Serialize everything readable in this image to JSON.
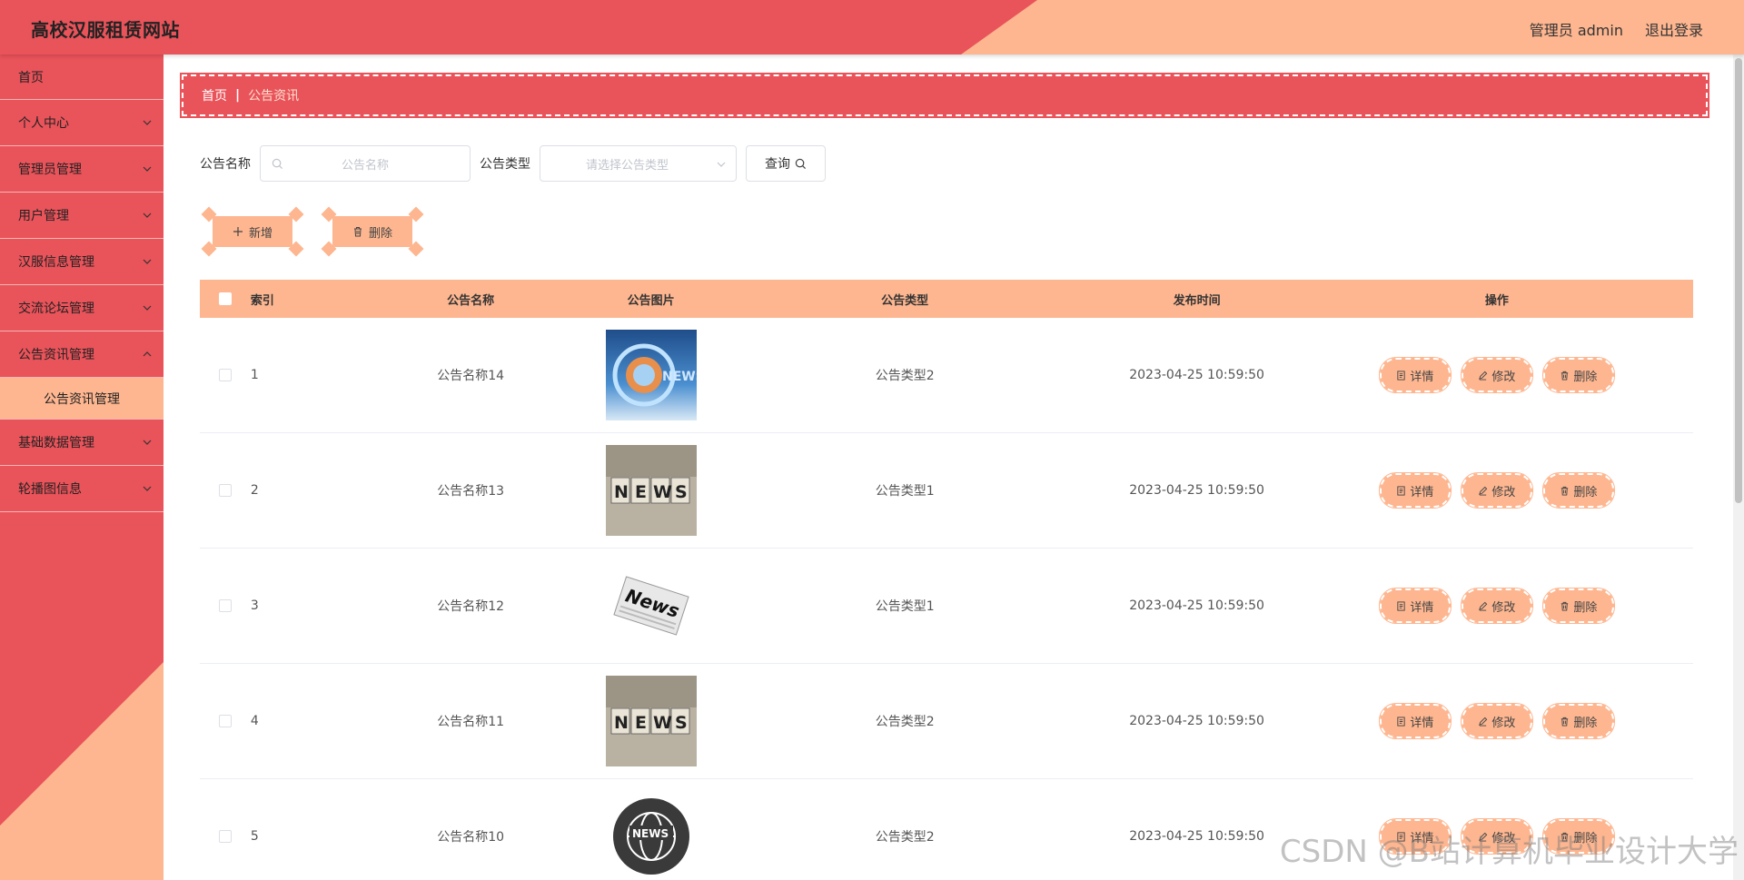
{
  "header": {
    "title": "高校汉服租赁网站",
    "user": "管理员 admin",
    "logout": "退出登录"
  },
  "sidebar": {
    "items": [
      {
        "label": "首页"
      },
      {
        "label": "个人中心"
      },
      {
        "label": "管理员管理"
      },
      {
        "label": "用户管理"
      },
      {
        "label": "汉服信息管理"
      },
      {
        "label": "交流论坛管理"
      },
      {
        "label": "公告资讯管理"
      },
      {
        "label": "基础数据管理"
      },
      {
        "label": "轮播图信息"
      }
    ],
    "active_sub": "公告资讯管理"
  },
  "breadcrumb": {
    "home": "首页",
    "sep": "|",
    "current": "公告资讯"
  },
  "search": {
    "name_label": "公告名称",
    "name_placeholder": "公告名称",
    "type_label": "公告类型",
    "type_placeholder": "请选择公告类型",
    "query": "查询"
  },
  "actions": {
    "add": "新增",
    "delete": "删除"
  },
  "table": {
    "headers": {
      "index": "索引",
      "name": "公告名称",
      "image": "公告图片",
      "type": "公告类型",
      "time": "发布时间",
      "ops": "操作"
    },
    "ops": {
      "detail": "详情",
      "edit": "修改",
      "delete": "删除"
    },
    "rows": [
      {
        "index": "1",
        "name": "公告名称14",
        "type": "公告类型2",
        "time": "2023-04-25 10:59:50",
        "image": "news-globe-blue"
      },
      {
        "index": "2",
        "name": "公告名称13",
        "type": "公告类型1",
        "time": "2023-04-25 10:59:50",
        "image": "news-cubes"
      },
      {
        "index": "3",
        "name": "公告名称12",
        "type": "公告类型1",
        "time": "2023-04-25 10:59:50",
        "image": "news-paper"
      },
      {
        "index": "4",
        "name": "公告名称11",
        "type": "公告类型2",
        "time": "2023-04-25 10:59:50",
        "image": "news-cubes"
      },
      {
        "index": "5",
        "name": "公告名称10",
        "type": "公告类型2",
        "time": "2023-04-25 10:59:50",
        "image": "news-globe-dark"
      }
    ]
  },
  "watermark": "CSDN @B站计算机毕业设计大学",
  "colors": {
    "primary": "#e9535a",
    "accent": "#fdb690"
  }
}
